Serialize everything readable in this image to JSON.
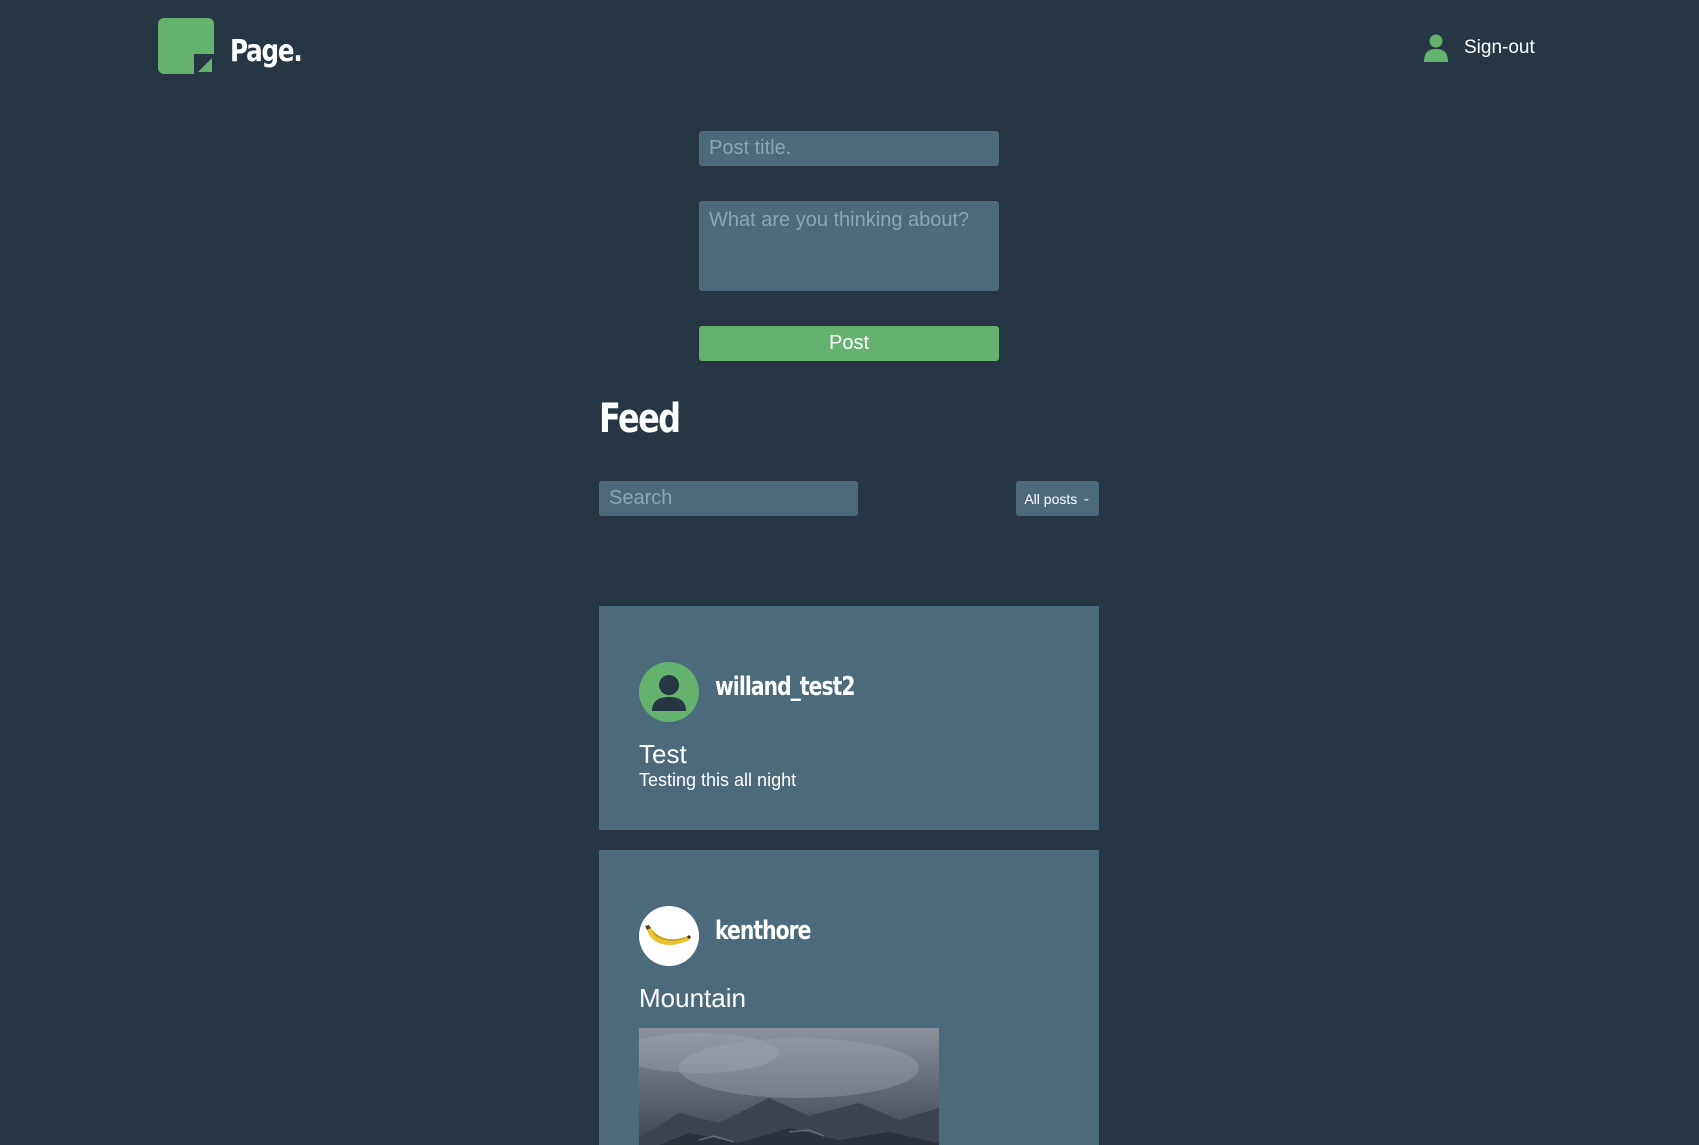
{
  "header": {
    "logo_text": "Page.",
    "signout_label": "Sign-out"
  },
  "composer": {
    "title_placeholder": "Post title.",
    "body_placeholder": "What are you thinking about?",
    "post_button_label": "Post"
  },
  "feed": {
    "heading": "Feed",
    "search_placeholder": "Search",
    "filter_selected": "All posts",
    "posts": [
      {
        "username": "willand_test2",
        "title": "Test",
        "body": "Testing this all night",
        "avatar": "default-user-icon"
      },
      {
        "username": "kenthore",
        "title": "Mountain",
        "avatar": "banana-icon",
        "image": "mountain-photo"
      }
    ]
  },
  "colors": {
    "background": "#263743",
    "card": "#4b6a7c",
    "accent": "#64b26d",
    "text": "#ffffff",
    "placeholder": "#8ea6b4"
  }
}
